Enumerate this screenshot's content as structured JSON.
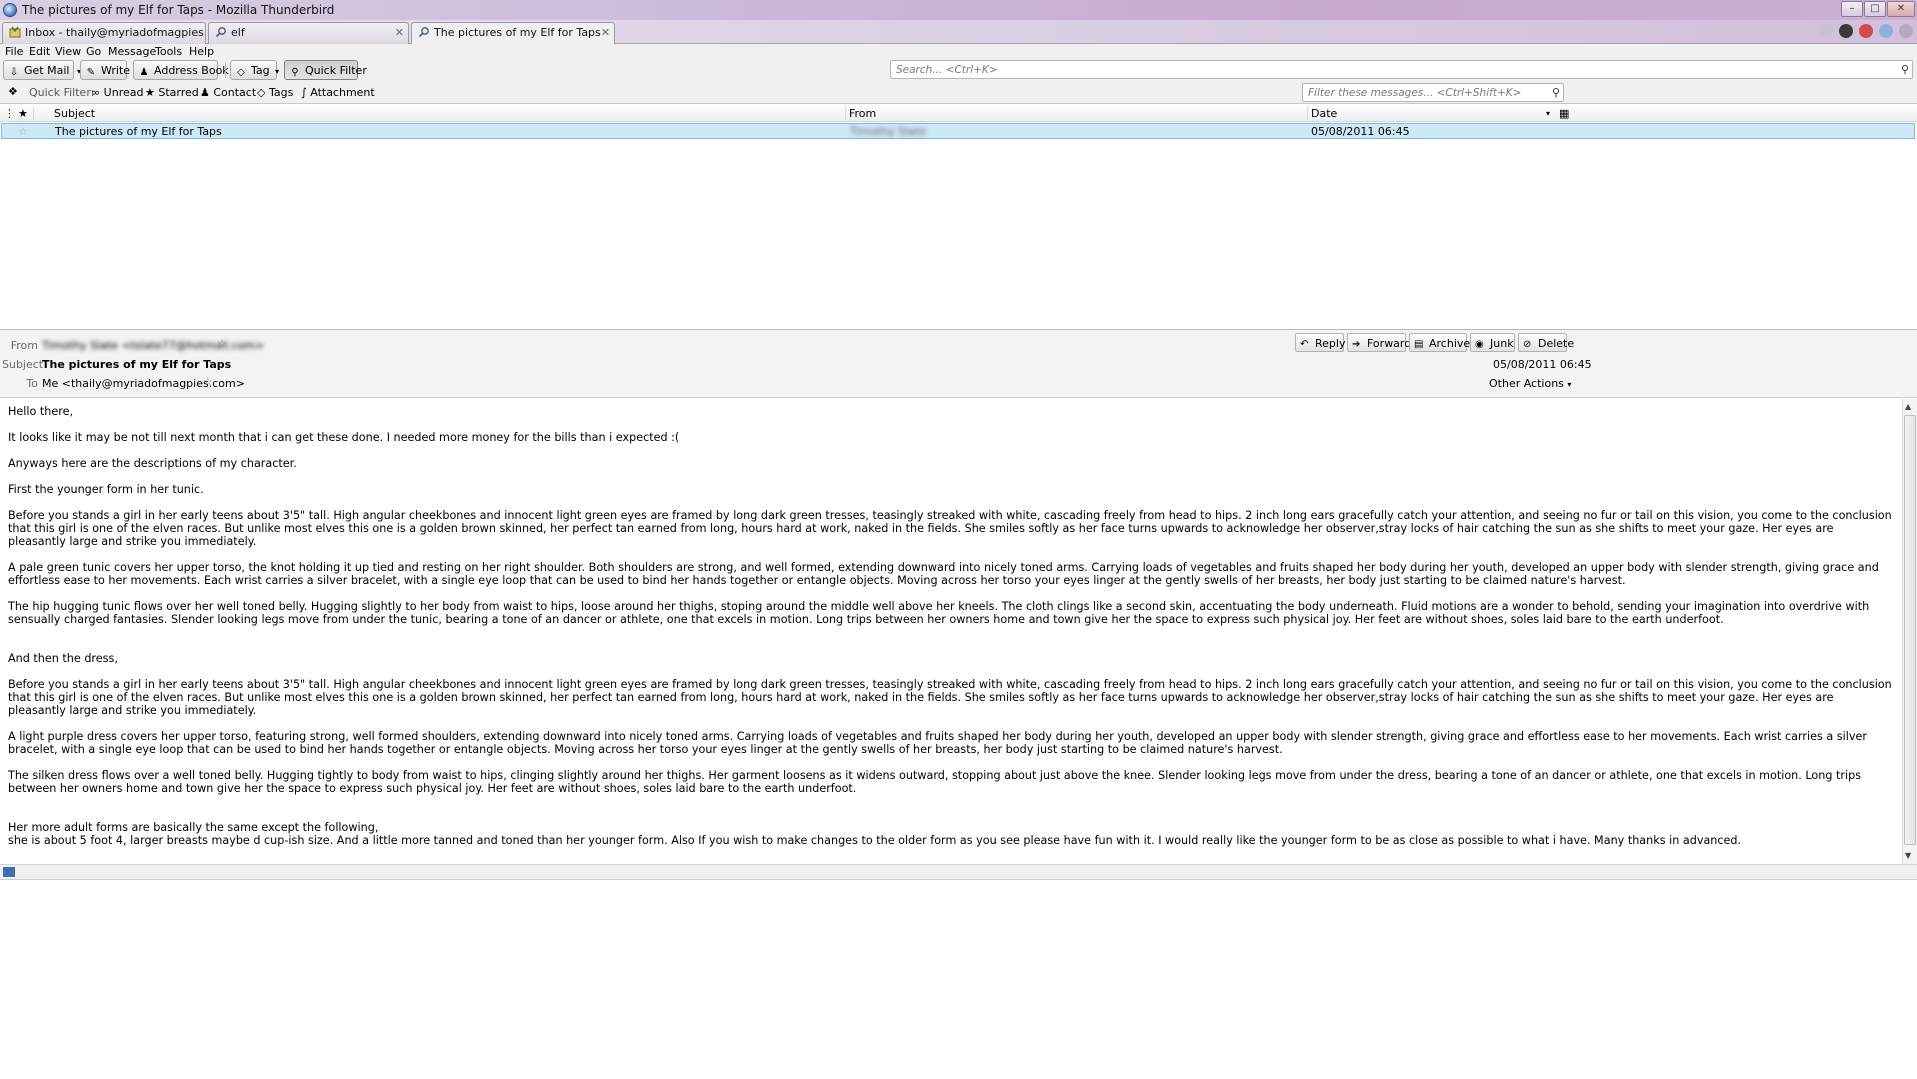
{
  "window": {
    "title": "The pictures of my Elf for Taps - Mozilla Thunderbird"
  },
  "tabs": [
    {
      "label": "Inbox - thaily@myriadofmagpies.com",
      "icon": "inbox-icon"
    },
    {
      "label": "elf",
      "icon": "search-icon"
    },
    {
      "label": "The pictures of my Elf for Taps",
      "icon": "search-icon",
      "active": true
    }
  ],
  "menubar": [
    "File",
    "Edit",
    "View",
    "Go",
    "Message",
    "Tools",
    "Help"
  ],
  "toolbar": {
    "get_mail": "Get Mail",
    "write": "Write",
    "address_book": "Address Book",
    "tag": "Tag",
    "quick_filter": "Quick Filter",
    "search_placeholder": "Search... <Ctrl+K>"
  },
  "quickfilter": {
    "label": "Quick Filter:",
    "unread": "Unread",
    "starred": "Starred",
    "contact": "Contact",
    "tags": "Tags",
    "attachment": "Attachment",
    "filter_placeholder": "Filter these messages... <Ctrl+Shift+K>"
  },
  "threadpane": {
    "columns": {
      "subject": "Subject",
      "from": "From",
      "date": "Date"
    },
    "rows": [
      {
        "subject": "The pictures of my Elf for Taps",
        "from": "Timothy Slate",
        "date": "05/08/2011 06:45",
        "selected": true
      }
    ]
  },
  "message": {
    "labels": {
      "from": "From",
      "subject": "Subject",
      "to": "To"
    },
    "from": "Timothy Slate <tslate77@hotmail.com>",
    "subject": "The pictures of my Elf for Taps",
    "to": "Me <thaily@myriadofmagpies.com>",
    "date": "05/08/2011 06:45",
    "actions": {
      "reply": "Reply",
      "forward": "Forward",
      "archive": "Archive",
      "junk": "Junk",
      "delete": "Delete",
      "other": "Other Actions"
    },
    "body": [
      "Hello there,",
      "It looks like it may be not till next month that i can get these done. I needed more money for the bills than i expected :(",
      "Anyways here are the descriptions of my character.",
      "First the younger form in her tunic.",
      "Before you stands a girl in her early teens about 3'5\" tall. High angular cheekbones and innocent light green eyes are framed by long dark green tresses, teasingly streaked with white, cascading freely from head to hips. 2 inch long ears gracefully catch your attention, and seeing no fur or tail on this vision, you come to the conclusion that this girl is one of the elven races. But unlike most elves this one is a golden brown skinned, her perfect tan earned from long, hours hard at work, naked in the fields. She smiles softly as her face turns upwards to acknowledge her observer,stray locks of hair catching the sun as she shifts to meet your gaze. Her eyes are pleasantly large and strike you immediately.",
      "A pale green tunic covers her upper torso, the knot holding it up tied and resting on her right shoulder. Both shoulders are strong, and well formed, extending downward into nicely toned arms. Carrying loads of vegetables and fruits shaped her body during her youth, developed an upper body with slender strength, giving grace and effortless ease to her movements. Each wrist carries a silver bracelet, with a single eye loop that can be used to bind her hands together or entangle objects. Moving across her torso your eyes linger at the gently swells of her breasts, her body just starting to be claimed nature's harvest.",
      "The hip hugging tunic flows over her well toned belly. Hugging slightly to her body from waist to hips, loose around her thighs, stoping around the middle well above her kneels. The cloth clings like a second skin, accentuating the body underneath. Fluid motions are a wonder to behold, sending your imagination  into overdrive with sensually charged fantasies. Slender looking legs move from under the tunic, bearing a tone of an dancer or athlete, one that excels in motion. Long trips between her owners home and town give her the space to express such physical joy.  Her feet are without shoes, soles laid bare to the earth underfoot.",
      "And then the dress,",
      "Before you stands a girl in her early teens about 3'5\" tall. High angular cheekbones and innocent light green eyes are framed by long dark green tresses, teasingly streaked with white, cascading freely from head to hips. 2 inch long ears gracefully catch your attention, and seeing no fur or tail on this vision, you come to the conclusion that this girl is one of the elven races. But unlike most elves this one is a golden brown skinned, her perfect tan earned from long, hours hard at work, naked in the fields. She smiles softly as her face turns upwards to acknowledge her observer,stray locks of hair catching the sun as she shifts to meet your gaze. Her eyes are pleasantly large and strike you immediately.",
      "A light purple dress covers her upper torso, featuring strong, well formed shoulders, extending downward into nicely toned arms. Carrying loads of vegetables and fruits shaped her body during her youth, developed an upper body with slender strength, giving grace and effortless ease to her movements. Each wrist carries a silver bracelet, with a single eye loop that can be used to bind her hands together or entangle objects. Moving across her torso your eyes linger at the gently swells of her breasts, her body just starting to be claimed nature's harvest.",
      "The silken dress flows over a well toned belly. Hugging tightly to body from waist to hips, clinging slightly around her thighs. Her garment loosens as it widens outward, stopping about just above the knee. Slender looking legs move from under the dress, bearing a tone of an dancer or athlete, one that excels in motion. Long trips between her owners home and town give her the space to express such physical joy.  Her feet are without shoes, soles laid bare to the earth underfoot.",
      "Her more adult forms are basically the same except the following,",
      "she is about 5 foot 4, larger breasts maybe d cup-ish size. And a little more tanned and toned than her younger form. Also If you wish to make changes to the older form as you see please have fun with it. I would really like the younger form to be as close as possible to what i have. Many thanks in advanced."
    ]
  }
}
